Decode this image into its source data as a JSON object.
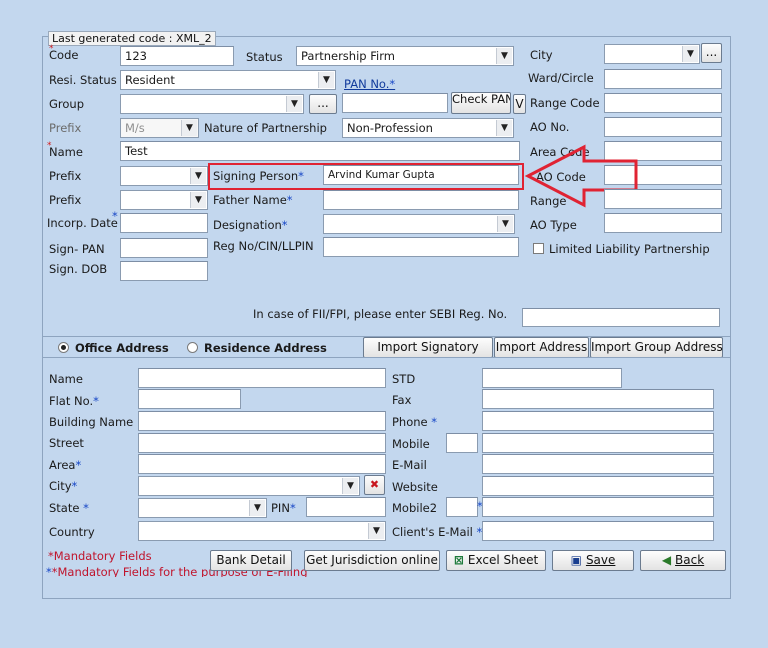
{
  "header": {
    "caption": "Last generated code : XML_2"
  },
  "form": {
    "code_label": "Code",
    "code_value": "123",
    "status_label": "Status",
    "status_value": "Partnership Firm",
    "city_label": "City",
    "city_value": "",
    "browse_label": "...",
    "resi_status_label": "Resi. Status",
    "resi_status_value": "Resident",
    "pan_label": "PAN No.",
    "ward_label": "Ward/Circle",
    "group_label": "Group",
    "group_value": "",
    "pan_value": "",
    "check_pan_label": "Check PAN",
    "v_label": "V",
    "range_code_label": "Range Code",
    "prefix_label": "Prefix",
    "prefix_value": "M/s",
    "nature_label": "Nature of Partnership",
    "nature_value": "Non-Profession",
    "ao_no_label": "AO No.",
    "name_label": "Name",
    "name_value": "Test",
    "area_code_label": "Area Code",
    "signing_person_label": "Signing Person",
    "signing_person_value": "Arvind Kumar Gupta",
    "ao_code_label": "AO Code",
    "father_name_label": "Father Name",
    "range_label": "Range",
    "incorp_date_label": "Incorp. Date",
    "designation_label": "Designation",
    "ao_type_label": "AO Type",
    "sign_pan_label": "Sign- PAN",
    "reg_no_label": "Reg No/CIN/LLPIN",
    "llp_label": "Limited Liability Partnership",
    "sign_dob_label": "Sign. DOB",
    "sebi_label": "In case of FII/FPI, please enter SEBI Reg. No."
  },
  "address": {
    "office_label": "Office Address",
    "residence_label": "Residence Address",
    "import_signatory": "Import Signatory",
    "import_address": "Import Address",
    "import_group_address": "Import Group Address",
    "name_label": "Name",
    "std_label": "STD",
    "flat_label": "Flat No.",
    "fax_label": "Fax",
    "building_label": "Building Name",
    "phone_label": "Phone",
    "street_label": "Street",
    "mobile_label": "Mobile",
    "area_label": "Area",
    "email_label": "E-Mail",
    "city_label": "City",
    "website_label": "Website",
    "state_label": "State",
    "pin_label": "PIN",
    "mobile2_label": "Mobile2",
    "country_label": "Country",
    "client_email_label": "Client's E-Mail"
  },
  "footer": {
    "mandatory1": "*Mandatory Fields",
    "mandatory2": "*Mandatory Fields for the purpose of E-Filing",
    "bank_detail": "Bank Detail",
    "jurisdiction": "Get Jurisdiction online",
    "excel": "Excel Sheet",
    "save": "Save",
    "back": "Back"
  },
  "colors": {
    "background": "#c3d7ee",
    "highlight": "#e02333",
    "required": "#1646c6",
    "mandatory_text": "#c0142c"
  }
}
